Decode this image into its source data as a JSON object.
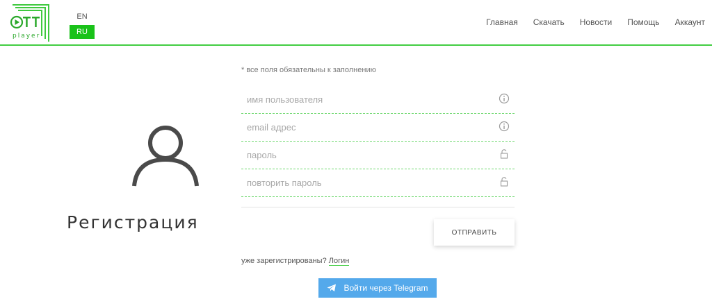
{
  "brand": {
    "logo_text": "OTT",
    "logo_sub": "player",
    "accent_color": "#41cd41"
  },
  "lang": {
    "en": "EN",
    "ru": "RU",
    "active": "RU"
  },
  "nav": {
    "items": [
      "Главная",
      "Скачать",
      "Новости",
      "Помощь",
      "Аккаунт"
    ]
  },
  "page": {
    "title": "Регистрация",
    "avatar_icon": "user-icon"
  },
  "form": {
    "note": "* все поля обязательны к заполнению",
    "fields": [
      {
        "placeholder": "имя пользователя",
        "icon": "info-icon"
      },
      {
        "placeholder": "email адрес",
        "icon": "info-icon"
      },
      {
        "placeholder": "пароль",
        "icon": "lock-icon"
      },
      {
        "placeholder": "повторить пароль",
        "icon": "lock-icon"
      }
    ],
    "submit_label": "ОТПРАВИТЬ",
    "already_text": "уже зарегистрированы?",
    "login_link": "Логин",
    "telegram_label": "Войти через Telegram",
    "telegram_color": "#54a9eb"
  }
}
